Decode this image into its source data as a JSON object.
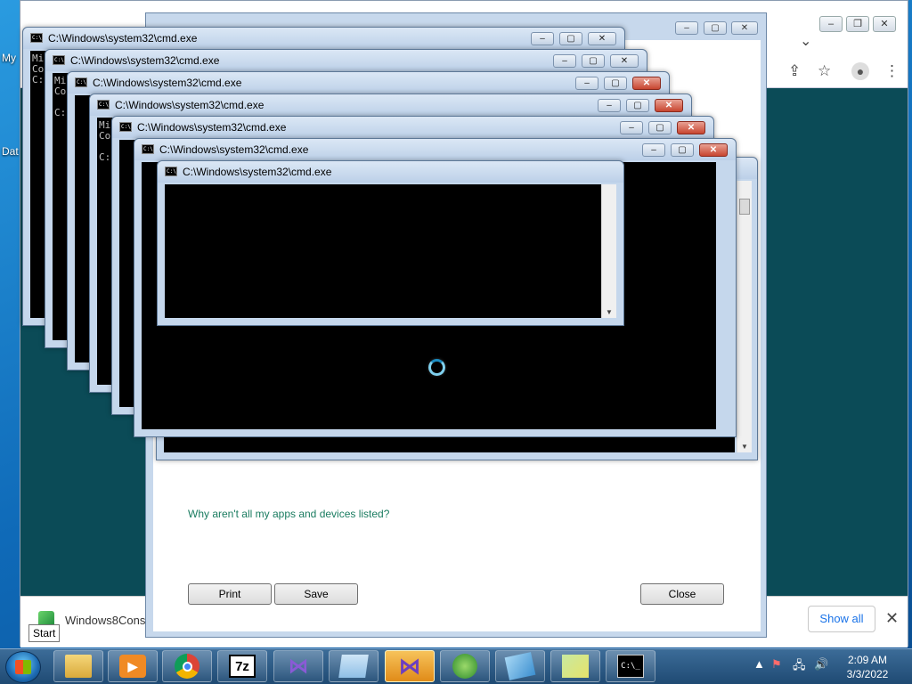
{
  "desktop": {
    "icon_labels": [
      "My",
      "Dat"
    ]
  },
  "chrome": {
    "download": {
      "filename": "Windows8Cons",
      "show_all": "Show all",
      "close": "✕"
    },
    "controls": {
      "minimize": "–",
      "restore": "❐",
      "close": "✕"
    },
    "tab_dropdown": "⌄"
  },
  "dialog": {
    "link": "Why aren't all my apps and devices listed?",
    "buttons": {
      "print": "Print",
      "save": "Save",
      "close": "Close"
    }
  },
  "cmd_windows": [
    {
      "title": "C:\\Windows\\system32\\cmd.exe",
      "lines": [
        "Mi",
        "Co",
        "",
        "C:"
      ]
    },
    {
      "title": "C:\\Windows\\system32\\cmd.exe",
      "lines": [
        "Mi",
        "Co",
        "",
        "C:"
      ]
    },
    {
      "title": "C:\\Windows\\system32\\cmd.exe",
      "lines": [
        "",
        "",
        "",
        "C:"
      ]
    },
    {
      "title": "C:\\Windows\\system32\\cmd.exe",
      "lines": [
        "Mi",
        "Co",
        "",
        "C:"
      ]
    },
    {
      "title": "C:\\Windows\\system32\\cmd.exe",
      "lines": []
    },
    {
      "title": "C:\\Windows\\system32\\cmd.exe",
      "lines": []
    },
    {
      "title": "C:\\Windows\\system32\\cmd.exe",
      "lines": []
    }
  ],
  "taskbar": {
    "start_tooltip": "Start",
    "apps": [
      {
        "name": "explorer",
        "icon": "folder-icon"
      },
      {
        "name": "media-player",
        "icon": "media-player-icon"
      },
      {
        "name": "chrome",
        "icon": "chrome-icon"
      },
      {
        "name": "7zip",
        "icon": "7zip-icon",
        "text": "7z"
      },
      {
        "name": "vs-installer",
        "icon": "visual-studio-installer-icon"
      },
      {
        "name": "notepad",
        "icon": "notepad-icon"
      },
      {
        "name": "visual-studio",
        "icon": "visual-studio-icon",
        "active": true
      },
      {
        "name": "windows-update",
        "icon": "windows-icon"
      },
      {
        "name": "app-a",
        "icon": "app-icon"
      },
      {
        "name": "app-b",
        "icon": "app-icon"
      },
      {
        "name": "cmd",
        "icon": "cmd-icon",
        "text": "C:\\_"
      }
    ],
    "clock": {
      "time": "2:09 AM",
      "date": "3/3/2022"
    }
  }
}
